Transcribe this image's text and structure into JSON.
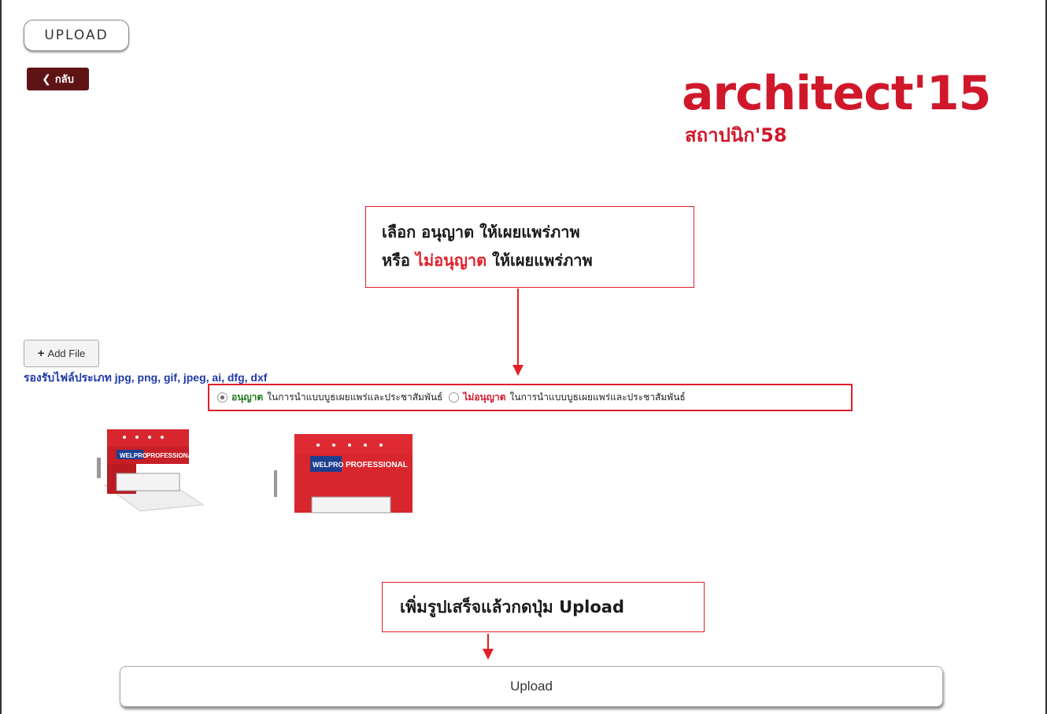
{
  "header": {
    "upload_tab": "UPLOAD",
    "back_label": "กลับ"
  },
  "logo": {
    "main": "architect'15",
    "sub": "สถาปนิก'58",
    "color": "#d0182b"
  },
  "callouts": {
    "permission": {
      "line1": "เลือก อนุญาต ให้เผยแพร่ภาพ",
      "line2_prefix": "หรือ ",
      "line2_highlight": "ไม่อนุญาต",
      "line2_suffix": " ให้เผยแพร่ภาพ"
    },
    "upload_hint": "เพิ่มรูปเสร็จแล้วกดปุ่ม Upload"
  },
  "add_file": {
    "label": "Add File",
    "supported_types": "รองรับไฟล์ประเภท jpg, png, gif, jpeg, ai, dfg, dxf"
  },
  "permission_options": [
    {
      "label": "อนุญาต",
      "desc": "ในการนำแบบบูธเผยแพร่และประชาสัมพันธ์",
      "selected": true
    },
    {
      "label": "ไม่อนุญาต",
      "desc": "ในการนำแบบบูธเผยแพร่และประชาสัมพันธ์",
      "selected": false
    }
  ],
  "thumbnails": [
    {
      "brand": "WELPRO",
      "title": "PROFESSIONAL"
    },
    {
      "brand": "WELPRO",
      "title": "PROFESSIONAL"
    }
  ],
  "upload_button": "Upload",
  "colors": {
    "accent_red": "#e0202a",
    "back_button": "#5e1414",
    "link_blue": "#1f3aa8",
    "allow_green": "#1f7a1f"
  }
}
